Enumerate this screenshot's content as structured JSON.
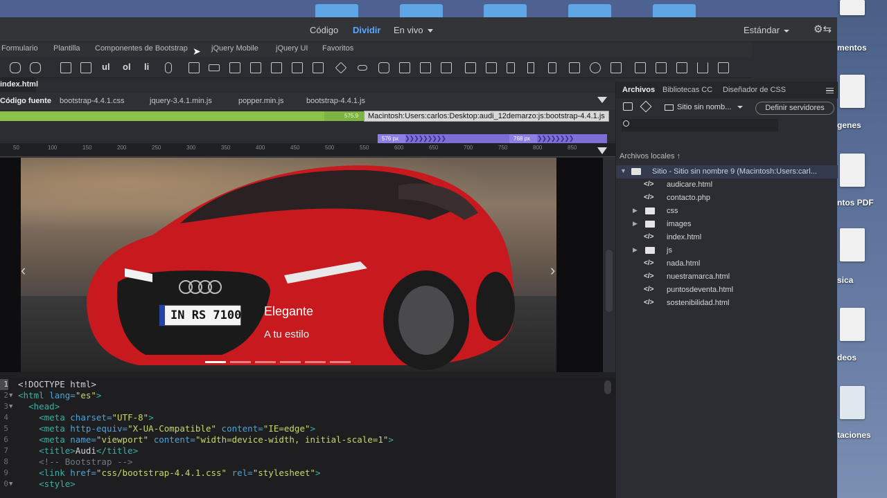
{
  "top_bar": {
    "view_buttons": [
      "Código",
      "Dividir",
      "En vivo"
    ],
    "workspace": "Estándar"
  },
  "insert_tabs": [
    "Formulario",
    "Plantilla",
    "Componentes de Bootstrap",
    "jQuery Mobile",
    "jQuery UI",
    "Favoritos"
  ],
  "iconbar_text": [
    "ul",
    "ol",
    "li"
  ],
  "document": {
    "tab": "index.html",
    "related_files": [
      "Código fuente",
      "bootstrap-4.4.1.css",
      "jquery-3.4.1.min.js",
      "popper.min.js",
      "bootstrap-4.4.1.js"
    ]
  },
  "media_queries": {
    "green_label": "575.9",
    "tooltip": "Macintosh:Users:carlos:Desktop:audi_12demarzo:js:bootstrap-4.4.1.js",
    "seg1": "576  px",
    "seg2": "768  px"
  },
  "ruler_labels": [
    "50",
    "100",
    "150",
    "200",
    "250",
    "300",
    "350",
    "400",
    "450",
    "500",
    "550",
    "600",
    "650",
    "700",
    "750",
    "800",
    "850"
  ],
  "live_view": {
    "caption_title": "Elegante",
    "caption_sub": "A tu estilo",
    "plate": "IN RS 7100",
    "prev_icon": "‹",
    "next_icon": "›"
  },
  "code_lines": [
    {
      "n": "1",
      "fold": "",
      "html": "<span>&lt;!DOCTYPE html&gt;</span>"
    },
    {
      "n": "2",
      "fold": "▼",
      "html": "<span class='tg'>&lt;html</span> <span class='at'>lang=</span><span class='st'>\"es\"</span><span class='tg'>&gt;</span>"
    },
    {
      "n": "3",
      "fold": "▼",
      "html": "  <span class='tg'>&lt;head&gt;</span>"
    },
    {
      "n": "4",
      "fold": "",
      "html": "    <span class='tg'>&lt;meta</span> <span class='at'>charset=</span><span class='st'>\"UTF-8\"</span><span class='tg'>&gt;</span>"
    },
    {
      "n": "5",
      "fold": "",
      "html": "    <span class='tg'>&lt;meta</span> <span class='at'>http-equiv=</span><span class='st'>\"X-UA-Compatible\"</span> <span class='at'>content=</span><span class='st'>\"IE=edge\"</span><span class='tg'>&gt;</span>"
    },
    {
      "n": "6",
      "fold": "",
      "html": "    <span class='tg'>&lt;meta</span> <span class='at'>name=</span><span class='st'>\"viewport\"</span> <span class='at'>content=</span><span class='st'>\"width=device-width, initial-scale=1\"</span><span class='tg'>&gt;</span>"
    },
    {
      "n": "7",
      "fold": "",
      "html": "    <span class='tg'>&lt;title&gt;</span>Audi<span class='tg'>&lt;/title&gt;</span>"
    },
    {
      "n": "8",
      "fold": "",
      "html": "    <span class='cm'>&lt;!-- Bootstrap --&gt;</span>"
    },
    {
      "n": "9",
      "fold": "",
      "html": "    <span class='tg'>&lt;link</span> <span class='at'>href=</span><span class='st'>\"css/bootstrap-4.4.1.css\"</span> <span class='at'>rel=</span><span class='st'>\"stylesheet\"</span><span class='tg'>&gt;</span>"
    },
    {
      "n": "0",
      "fold": "▼",
      "html": "    <span class='tg'>&lt;style&gt;</span>"
    }
  ],
  "files_panel": {
    "tabs": [
      "Archivos",
      "Bibliotecas CC",
      "Diseñador de CSS"
    ],
    "site_select": "Sitio sin nomb...",
    "define_servers": "Definir servidores",
    "local_files": "Archivos locales",
    "site_root": "Sitio - Sitio sin nombre 9 (Macintosh:Users:carl...",
    "items": [
      {
        "type": "file",
        "name": "audicare.html"
      },
      {
        "type": "file",
        "name": "contacto.php"
      },
      {
        "type": "folder",
        "name": "css"
      },
      {
        "type": "folder",
        "name": "images"
      },
      {
        "type": "file",
        "name": "index.html"
      },
      {
        "type": "folder",
        "name": "js"
      },
      {
        "type": "file",
        "name": "nada.html"
      },
      {
        "type": "file",
        "name": "nuestramarca.html"
      },
      {
        "type": "file",
        "name": "puntosdeventa.html"
      },
      {
        "type": "file",
        "name": "sostenibilidad.html"
      }
    ]
  },
  "desktop_labels": [
    "mentos",
    "genes",
    "ntos PDF",
    "sica",
    "deos",
    "taciones"
  ],
  "colors": {
    "accent_blue": "#5aa7ff",
    "mq_green": "#8bc34a",
    "mq_purple": "#7b6fd6",
    "car_red": "#c8191e"
  }
}
